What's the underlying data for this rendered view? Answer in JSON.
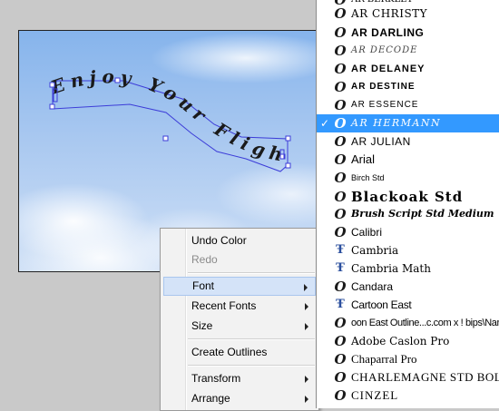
{
  "artwork": {
    "path_text": "Enjoy Your Flight"
  },
  "context_menu": {
    "items": [
      {
        "label": "Undo Color",
        "disabled": false,
        "submenu": false
      },
      {
        "label": "Redo",
        "disabled": true,
        "submenu": false
      },
      {
        "label": "Font",
        "disabled": false,
        "submenu": true,
        "highlighted": true
      },
      {
        "label": "Recent Fonts",
        "disabled": false,
        "submenu": true
      },
      {
        "label": "Size",
        "disabled": false,
        "submenu": true
      },
      {
        "label": "Create Outlines",
        "disabled": false,
        "submenu": false
      },
      {
        "label": "Transform",
        "disabled": false,
        "submenu": true
      },
      {
        "label": "Arrange",
        "disabled": false,
        "submenu": true
      }
    ]
  },
  "font_list": {
    "fonts": [
      {
        "name": "AR BERKLEY",
        "icon": "opentype-icon"
      },
      {
        "name": "AR CHRISTY",
        "icon": "opentype-icon"
      },
      {
        "name": "AR DARLING",
        "icon": "opentype-icon"
      },
      {
        "name": "AR DECODE",
        "icon": "opentype-icon"
      },
      {
        "name": "AR DELANEY",
        "icon": "opentype-icon"
      },
      {
        "name": "AR DESTINE",
        "icon": "opentype-icon"
      },
      {
        "name": "AR ESSENCE",
        "icon": "opentype-icon"
      },
      {
        "name": "AR HERMANN",
        "icon": "opentype-icon",
        "selected": true,
        "checked": true
      },
      {
        "name": "AR JULIAN",
        "icon": "opentype-icon"
      },
      {
        "name": "Arial",
        "icon": "opentype-icon"
      },
      {
        "name": "Birch Std",
        "icon": "opentype-icon"
      },
      {
        "name": "Blackoak Std",
        "icon": "opentype-icon"
      },
      {
        "name": "Brush Script Std Medium",
        "icon": "opentype-icon"
      },
      {
        "name": "Calibri",
        "icon": "opentype-icon"
      },
      {
        "name": "Cambria",
        "icon": "truetype-icon"
      },
      {
        "name": "Cambria Math",
        "icon": "truetype-icon"
      },
      {
        "name": "Candara",
        "icon": "opentype-icon"
      },
      {
        "name": "Cartoon East",
        "icon": "truetype-icon"
      },
      {
        "name": "oon East Outline...c.com x ! bips\\Nar",
        "icon": "opentype-icon"
      },
      {
        "name": "Adobe Caslon Pro",
        "icon": "opentype-icon"
      },
      {
        "name": "Chaparral Pro",
        "icon": "opentype-icon"
      },
      {
        "name": "CHARLEMAGNE STD BOLD",
        "icon": "opentype-icon"
      },
      {
        "name": "CINZEL",
        "icon": "opentype-icon"
      }
    ]
  },
  "colors": {
    "selection_blue": "#3399ff",
    "menu_highlight": "#d4e3f8",
    "path_outline": "#3c3cd8"
  }
}
